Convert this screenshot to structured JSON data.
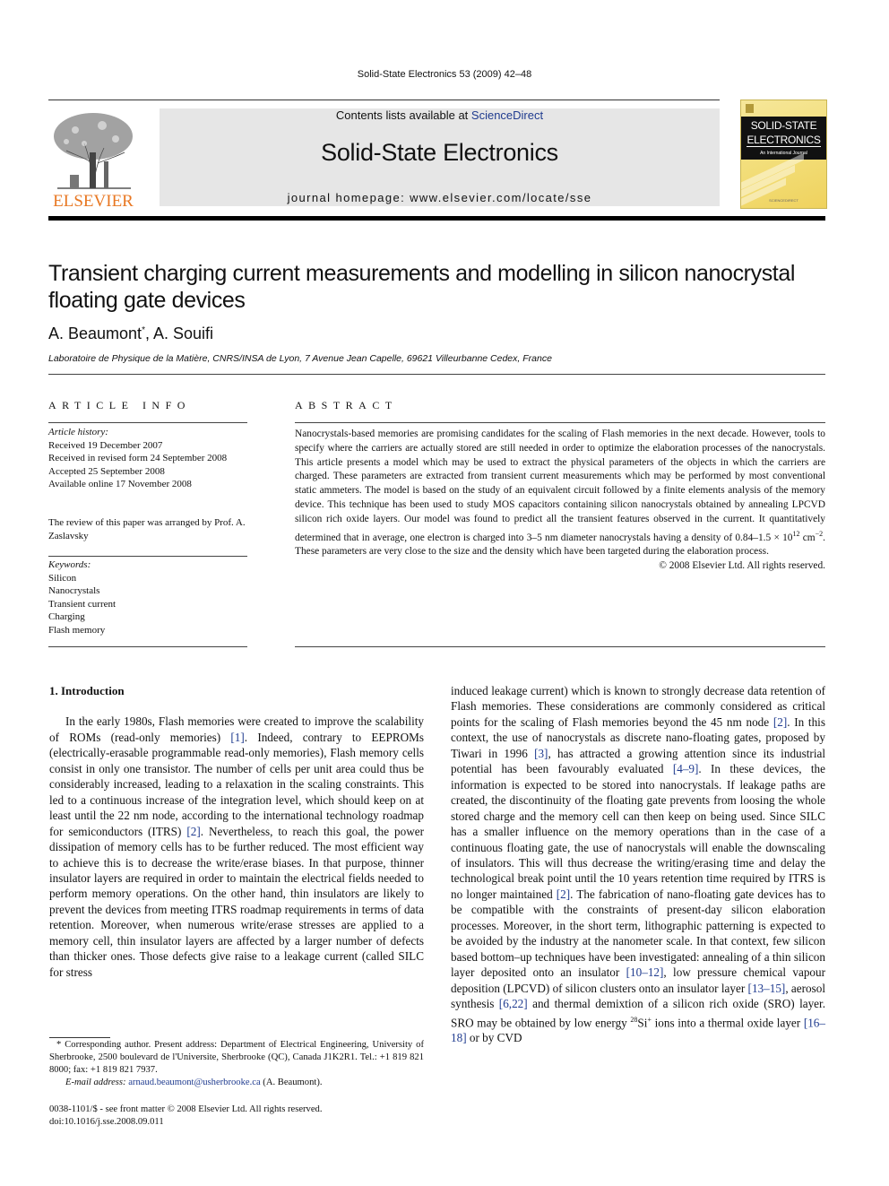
{
  "running_header": "Solid-State Electronics 53 (2009) 42–48",
  "publisher": {
    "logo_text": "ELSEVIER",
    "logo_color": "#e87722"
  },
  "banner": {
    "contents_prefix": "Contents lists available at ",
    "contents_link": "ScienceDirect",
    "journal_title": "Solid-State Electronics",
    "homepage": "journal homepage: www.elsevier.com/locate/sse",
    "link_color": "#1f3b8f"
  },
  "cover": {
    "line1": "SOLID-STATE",
    "line2": "ELECTRONICS",
    "line3": "An International Journal",
    "publisher": "SCIENCEDIRECT"
  },
  "article": {
    "title": "Transient charging current measurements and modelling in silicon nanocrystal floating gate devices",
    "author1": "A. Beaumont",
    "author1_mark": "*",
    "author_sep": ", ",
    "author2": "A. Souifi",
    "affiliation": "Laboratoire de Physique de la Matière, CNRS/INSA de Lyon, 7 Avenue Jean Capelle, 69621 Villeurbanne Cedex, France"
  },
  "article_info": {
    "heading": "ARTICLE INFO",
    "history_label": "Article history:",
    "history": [
      "Received 19 December 2007",
      "Received in revised form 24 September 2008",
      "Accepted 25 September 2008",
      "Available online 17 November 2008"
    ],
    "review_note": "The review of this paper was arranged by Prof. A. Zaslavsky",
    "keywords_label": "Keywords:",
    "keywords": [
      "Silicon",
      "Nanocrystals",
      "Transient current",
      "Charging",
      "Flash memory"
    ]
  },
  "abstract": {
    "heading": "ABSTRACT",
    "text_a": "Nanocrystals-based memories are promising candidates for the scaling of Flash memories in the next decade. However, tools to specify where the carriers are actually stored are still needed in order to optimize the elaboration processes of the nanocrystals. This article presents a model which may be used to extract the physical parameters of the objects in which the carriers are charged. These parameters are extracted from transient current measurements which may be performed by most conventional static ammeters. The model is based on the study of an equivalent circuit followed by a finite elements analysis of the memory device. This technique has been used to study MOS capacitors containing silicon nanocrystals obtained by annealing LPCVD silicon rich oxide layers. Our model was found to predict all the transient features observed in the current. It quantitatively determined that in average, one electron is charged into 3–5 nm diameter nanocrystals having a density of 0.84–1.5 × 10",
    "exp1": "12",
    "text_b": " cm",
    "exp2": "−2",
    "text_c": ". These parameters are very close to the size and the density which have been targeted during the elaboration process.",
    "copyright": "© 2008 Elsevier Ltd. All rights reserved."
  },
  "intro": {
    "heading": "1. Introduction",
    "p1": [
      "In the early 1980s, Flash memories were created to improve the scalability of ROMs (read-only memories) ",
      "[1]",
      ". Indeed, contrary to EEPROMs (electrically-erasable programmable read-only memories), Flash memory cells consist in only one transistor. The number of cells per unit area could thus be considerably increased, leading to a relaxation in the scaling constraints. This led to a continuous increase of the integration level, which should keep on at least until the 22 nm node, according to the international technology roadmap for semiconductors (ITRS) ",
      "[2]",
      ". Nevertheless, to reach this goal, the power dissipation of memory cells has to be further reduced. The most efficient way to achieve this is to decrease the write/erase biases. In that purpose, thinner insulator layers are required in order to maintain the electrical fields needed to perform memory operations. On the other hand, thin insulators are likely to prevent the devices from meeting ITRS roadmap requirements in terms of data retention. Moreover, when numerous write/erase stresses are applied to a memory cell, thin insulator layers are affected by a larger number of defects than thicker ones. Those defects give raise to a leakage current (called SILC for stress"
    ],
    "col2": [
      "induced leakage current) which is known to strongly decrease data retention of Flash memories. These considerations are commonly considered as critical points for the scaling of Flash memories beyond the 45 nm node ",
      "[2]",
      ". In this context, the use of nanocrystals as discrete nano-floating gates, proposed by Tiwari in 1996 ",
      "[3]",
      ", has attracted a growing attention since its industrial potential has been favourably evaluated ",
      "[4–9]",
      ". In these devices, the information is expected to be stored into nanocrystals. If leakage paths are created, the discontinuity of the floating gate prevents from loosing the whole stored charge and the memory cell can then keep on being used. Since SILC has a smaller influence on the memory operations than in the case of a continuous floating gate, the use of nanocrystals will enable the downscaling of insulators. This will thus decrease the writing/erasing time and delay the technological break point until the 10 years retention time required by ITRS is no longer maintained ",
      "[2]",
      ". The fabrication of nano-floating gate devices has to be compatible with the constraints of present-day silicon elaboration processes. Moreover, in the short term, lithographic patterning is expected to be avoided by the industry at the nanometer scale. In that context, few silicon based bottom–up techniques have been investigated: annealing of a thin silicon layer deposited onto an insulator ",
      "[10–12]",
      ", low pressure chemical vapour deposition (LPCVD) of silicon clusters onto an insulator layer ",
      "[13–15]",
      ", aerosol synthesis ",
      "[6,22]",
      " and thermal demixtion of a silicon rich oxide (SRO) layer. SRO may be obtained by low energy ",
      "28",
      "Si",
      "+",
      " ions into a thermal oxide layer ",
      "[16–18]",
      " or by CVD"
    ]
  },
  "footnote": {
    "mark": "*",
    "text": " Corresponding author. Present address: Department of Electrical Engineering, University of Sherbrooke, 2500 boulevard de l'Universite, Sherbrooke (QC), Canada J1K2R1. Tel.: +1 819 821 8000; fax: +1 819 821 7937.",
    "email_label": "E-mail address:",
    "email": "arnaud.beaumont@usherbrooke.ca",
    "email_suffix": " (A. Beaumont)."
  },
  "front_matter": {
    "issn": "0038-1101/$ - see front matter © 2008 Elsevier Ltd. All rights reserved.",
    "doi": "doi:10.1016/j.sse.2008.09.011"
  }
}
